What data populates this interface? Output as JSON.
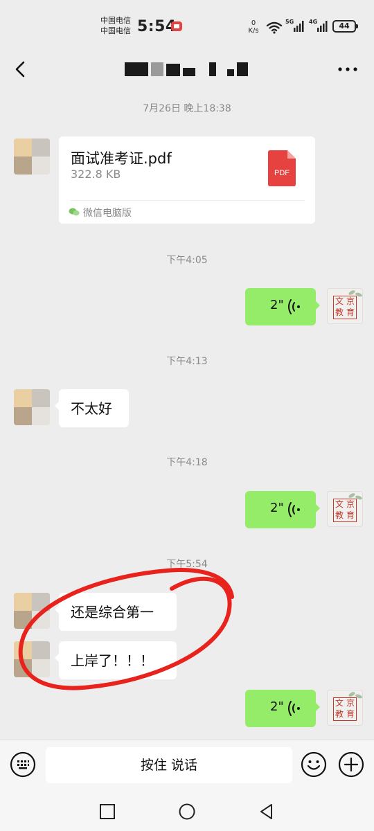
{
  "status_bar": {
    "carrier_1": "中国电信",
    "carrier_2": "中国电信",
    "time": "5:54",
    "speed_value": "0",
    "speed_unit": "K/s",
    "signal_1": "5G",
    "signal_2": "4G",
    "battery": "44"
  },
  "header": {
    "title": "",
    "back_icon": "chevron-left-icon",
    "more_icon": "ellipsis-icon"
  },
  "messages": {
    "ts1": "7月26日 晚上18:38",
    "file": {
      "name": "面试准考证.pdf",
      "size": "322.8 KB",
      "icon_text": "PDF",
      "source": "微信电脑版"
    },
    "ts2": "下午4:05",
    "voice1": "2\"",
    "ts3": "下午4:13",
    "text1": "不太好",
    "ts4": "下午4:18",
    "voice2": "2\"",
    "ts5": "下午5:54",
    "text2": "还是综合第一",
    "text3": "上岸了！！！",
    "voice3": "2\""
  },
  "my_avatar": {
    "chars": [
      "文",
      "京",
      "教",
      "育"
    ]
  },
  "input_bar": {
    "hold_to_talk": "按住 说话",
    "keyboard_icon": "keyboard-icon",
    "emoji_icon": "smiley-icon",
    "plus_icon": "plus-circle-icon"
  },
  "colors": {
    "background": "#ededed",
    "my_bubble": "#95ec69",
    "other_bubble": "#ffffff",
    "pdf_red": "#e64340",
    "annotation": "#e8231d"
  }
}
